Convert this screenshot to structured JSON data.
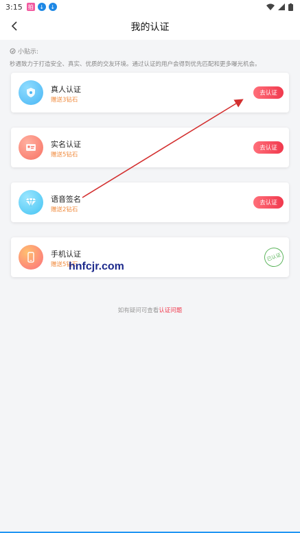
{
  "status_bar": {
    "time": "3:15",
    "app_icon_1": "拍",
    "app_icon_2": "↓",
    "app_icon_3": "↓"
  },
  "header": {
    "title": "我的认证"
  },
  "tip": {
    "title": "小贴示:",
    "text": "秒遇致力于打造安全、真实、优质的交友环境。通过认证的用户会得到优先匹配和更多曝光机会。"
  },
  "cards": [
    {
      "label": "真人认证",
      "reward": "赠送3钻石",
      "action": "去认证",
      "icon": "shield-icon",
      "color": "#49b6f4"
    },
    {
      "label": "实名认证",
      "reward": "赠送5钻石",
      "action": "去认证",
      "icon": "id-card-icon",
      "color": "#f87163"
    },
    {
      "label": "语音签名",
      "reward": "赠送2钻石",
      "action": "去认证",
      "icon": "diamond-icon",
      "color": "#44c3f2"
    },
    {
      "label": "手机认证",
      "reward": "赠送5钻石",
      "status": "已认证",
      "icon": "phone-icon",
      "color": "#fc6e7c"
    }
  ],
  "help": {
    "prefix": "如有疑问可查看",
    "link": "认证问题"
  },
  "watermark": "hnfcjr.com",
  "colors": {
    "accent": "#f0394d",
    "reward": "#f08a3c",
    "verified": "#5bb45b",
    "annotation_arrow": "#d32f2f"
  }
}
